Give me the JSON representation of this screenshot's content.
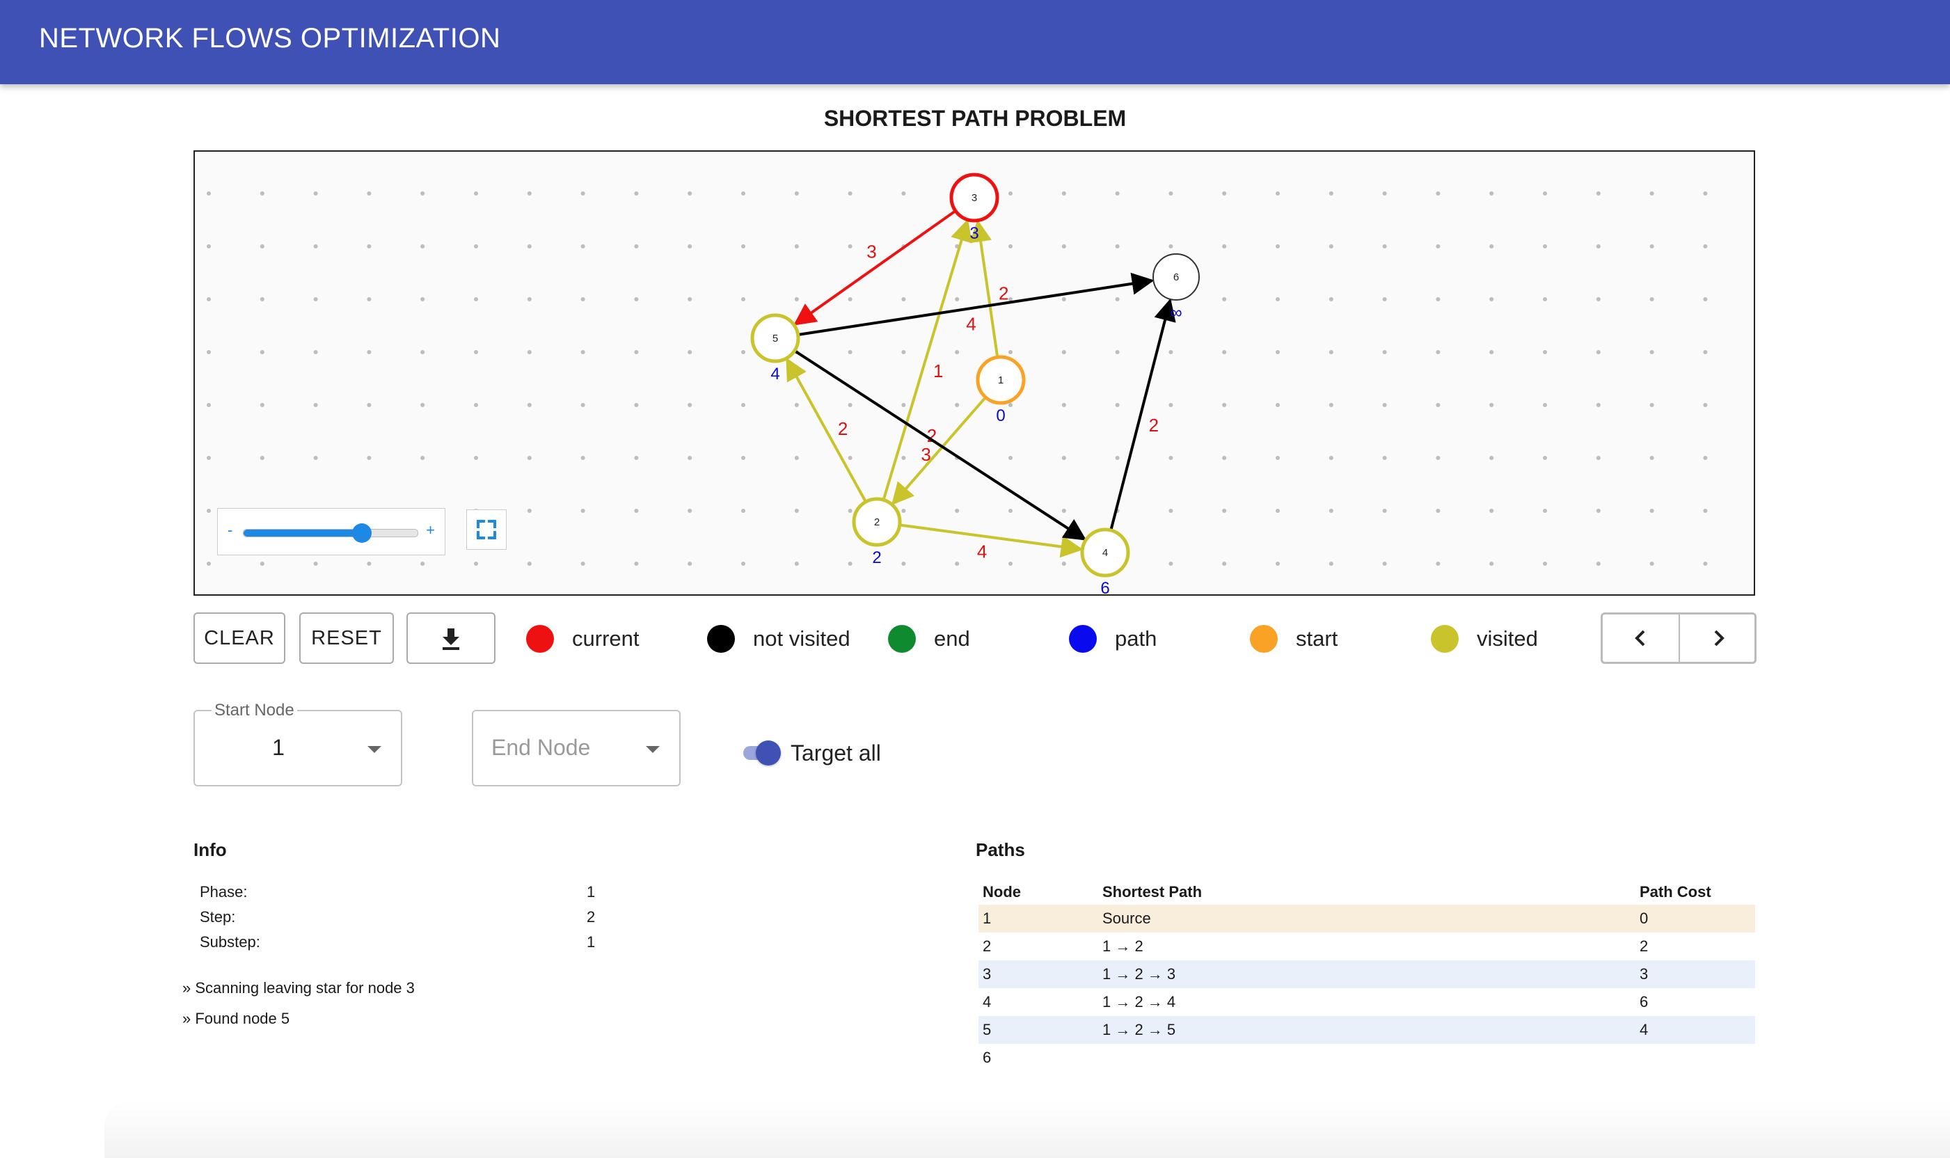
{
  "app": {
    "title": "NETWORK FLOWS OPTIMIZATION"
  },
  "page": {
    "title": "SHORTEST PATH PROBLEM"
  },
  "colors": {
    "appbar": "#3f51b5",
    "current": "#ee1111",
    "not_visited": "#000000",
    "end": "#0f8a2e",
    "path": "#0a0aee",
    "start": "#f9a225",
    "visited": "#c9c42c",
    "edge_weight": "#e01010",
    "distance": "#0a0acc"
  },
  "graph": {
    "nodes": [
      {
        "id": "1",
        "distance": "0",
        "state": "start"
      },
      {
        "id": "2",
        "distance": "2",
        "state": "visited"
      },
      {
        "id": "3",
        "distance": "3",
        "state": "current"
      },
      {
        "id": "4",
        "distance": "6",
        "state": "visited"
      },
      {
        "id": "5",
        "distance": "4",
        "state": "visited"
      },
      {
        "id": "6",
        "distance": "∞",
        "state": "not_visited"
      }
    ],
    "edges": [
      {
        "from": "1",
        "to": "3",
        "weight": "2",
        "state": "visited"
      },
      {
        "from": "1",
        "to": "2",
        "weight": "2",
        "state": "visited"
      },
      {
        "from": "2",
        "to": "5",
        "weight": "2",
        "state": "visited"
      },
      {
        "from": "2",
        "to": "3",
        "weight": "1",
        "state": "visited"
      },
      {
        "from": "2",
        "to": "4",
        "weight": "4",
        "state": "visited"
      },
      {
        "from": "3",
        "to": "5",
        "weight": "3",
        "state": "current"
      },
      {
        "from": "5",
        "to": "6",
        "weight": "4",
        "state": "not_visited"
      },
      {
        "from": "5",
        "to": "4",
        "weight": "3",
        "state": "not_visited"
      },
      {
        "from": "4",
        "to": "6",
        "weight": "2",
        "state": "not_visited"
      }
    ],
    "zoom": {
      "min_label": "-",
      "max_label": "+",
      "value": 0.68
    }
  },
  "controls": {
    "clear_label": "CLEAR",
    "reset_label": "RESET",
    "download_icon": "download-icon",
    "prev_icon": "chevron-left-icon",
    "next_icon": "chevron-right-icon"
  },
  "legend": [
    {
      "label": "current",
      "color": "#ee1111"
    },
    {
      "label": "not visited",
      "color": "#000000"
    },
    {
      "label": "end",
      "color": "#0f8a2e"
    },
    {
      "label": "path",
      "color": "#0a0aee"
    },
    {
      "label": "start",
      "color": "#f9a225"
    },
    {
      "label": "visited",
      "color": "#c9c42c"
    }
  ],
  "form": {
    "start_node_label": "Start Node",
    "start_node_value": "1",
    "end_node_placeholder": "End Node",
    "target_all_label": "Target all",
    "target_all_checked": true
  },
  "info": {
    "title": "Info",
    "rows": [
      {
        "key": "Phase:",
        "value": "1"
      },
      {
        "key": "Step:",
        "value": "2"
      },
      {
        "key": "Substep:",
        "value": "1"
      }
    ],
    "log": [
      "»  Scanning leaving star for node 3",
      "»  Found node 5"
    ]
  },
  "paths": {
    "title": "Paths",
    "headers": [
      "Node",
      "Shortest Path",
      "Path Cost"
    ],
    "rows": [
      [
        "1",
        "Source",
        "0"
      ],
      [
        "2",
        "1 → 2",
        "2"
      ],
      [
        "3",
        "1 → 2 → 3",
        "3"
      ],
      [
        "4",
        "1 → 2 → 4",
        "6"
      ],
      [
        "5",
        "1 → 2 → 5",
        "4"
      ],
      [
        "6",
        "",
        ""
      ]
    ]
  }
}
